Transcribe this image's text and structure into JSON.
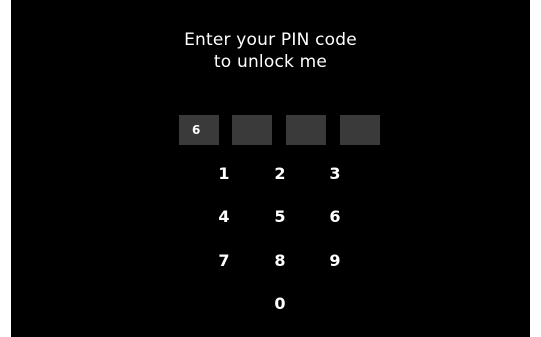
{
  "prompt": {
    "line1": "Enter your PIN code",
    "line2": "to unlock me"
  },
  "pin": {
    "digits": [
      "6",
      "",
      "",
      ""
    ]
  },
  "keypad": {
    "keys": [
      "1",
      "2",
      "3",
      "4",
      "5",
      "6",
      "7",
      "8",
      "9",
      "0"
    ]
  },
  "colors": {
    "background": "#000000",
    "text": "#ffffff",
    "pin_box": "#3a3a3a"
  }
}
